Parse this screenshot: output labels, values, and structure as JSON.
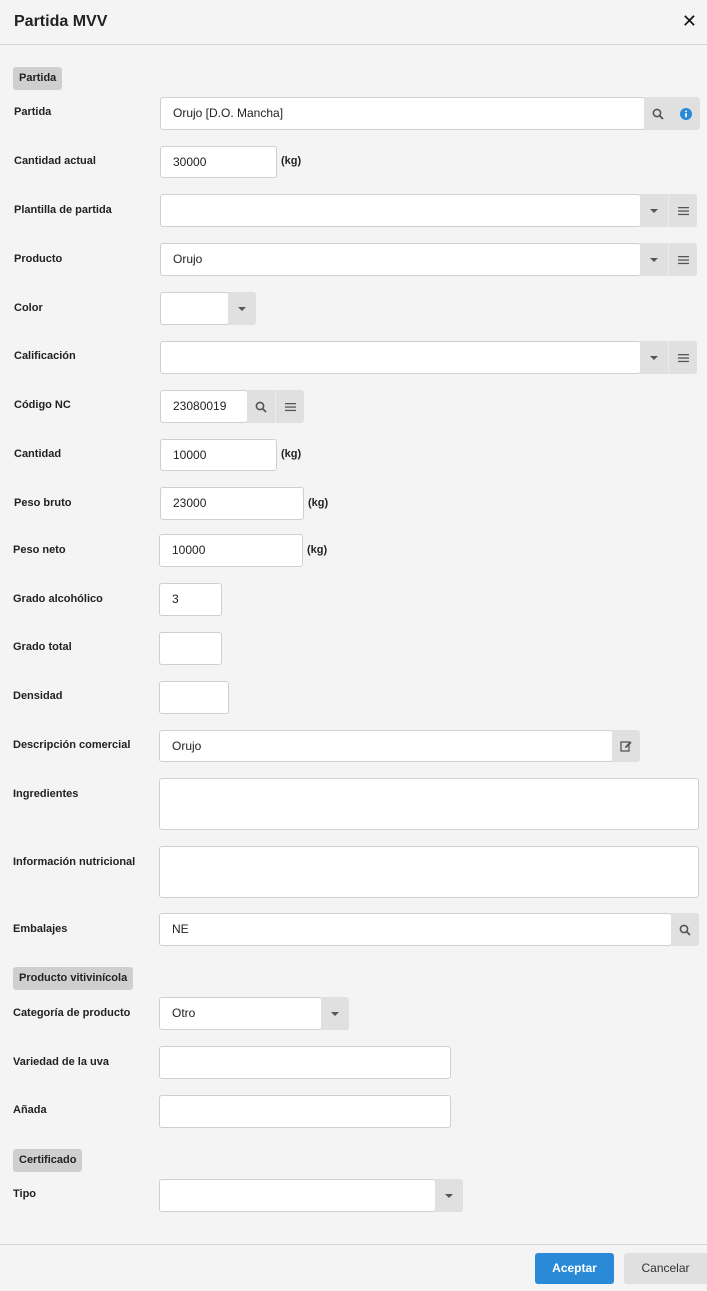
{
  "window": {
    "title": "Partida MVV",
    "close_label": "✕"
  },
  "sections": {
    "partida": "Partida",
    "producto_vitivinicola": "Producto vitivinícola",
    "certificado": "Certificado"
  },
  "fields": {
    "partida": {
      "label": "Partida",
      "value": "Orujo [D.O. Mancha]"
    },
    "cantidad_actual": {
      "label": "Cantidad actual",
      "value": "30000",
      "unit": "(kg)"
    },
    "plantilla_partida": {
      "label": "Plantilla de partida",
      "value": ""
    },
    "producto": {
      "label": "Producto",
      "value": "Orujo"
    },
    "color": {
      "label": "Color",
      "value": ""
    },
    "calificacion": {
      "label": "Calificación",
      "value": ""
    },
    "codigo_nc": {
      "label": "Código NC",
      "value": "23080019"
    },
    "cantidad": {
      "label": "Cantidad",
      "value": "10000",
      "unit": "(kg)"
    },
    "peso_bruto": {
      "label": "Peso bruto",
      "value": "23000",
      "unit": "(kg)"
    },
    "peso_neto": {
      "label": "Peso neto",
      "value": "10000",
      "unit": "(kg)"
    },
    "grado_alcoholico": {
      "label": "Grado alcohólico",
      "value": "3"
    },
    "grado_total": {
      "label": "Grado total",
      "value": ""
    },
    "densidad": {
      "label": "Densidad",
      "value": ""
    },
    "descripcion_comercial": {
      "label": "Descripción comercial",
      "value": "Orujo"
    },
    "ingredientes": {
      "label": "Ingredientes",
      "value": ""
    },
    "informacion_nutricional": {
      "label": "Información nutricional",
      "value": ""
    },
    "embalajes": {
      "label": "Embalajes",
      "value": "NE"
    },
    "categoria_producto": {
      "label": "Categoría de producto",
      "value": "Otro"
    },
    "variedad_uva": {
      "label": "Variedad de la uva",
      "value": ""
    },
    "anada": {
      "label": "Añada",
      "value": ""
    },
    "tipo": {
      "label": "Tipo",
      "value": ""
    }
  },
  "icons": {
    "search": "magnifier",
    "info": "info-circle",
    "dropdown": "caret-down",
    "list": "hamburger-lines",
    "edit": "pencil-square"
  },
  "colors": {
    "primary": "#2b8ad8",
    "info": "#2b8ad8",
    "background": "#f4f4f4"
  },
  "footer": {
    "accept_label": "Aceptar",
    "cancel_label": "Cancelar"
  }
}
